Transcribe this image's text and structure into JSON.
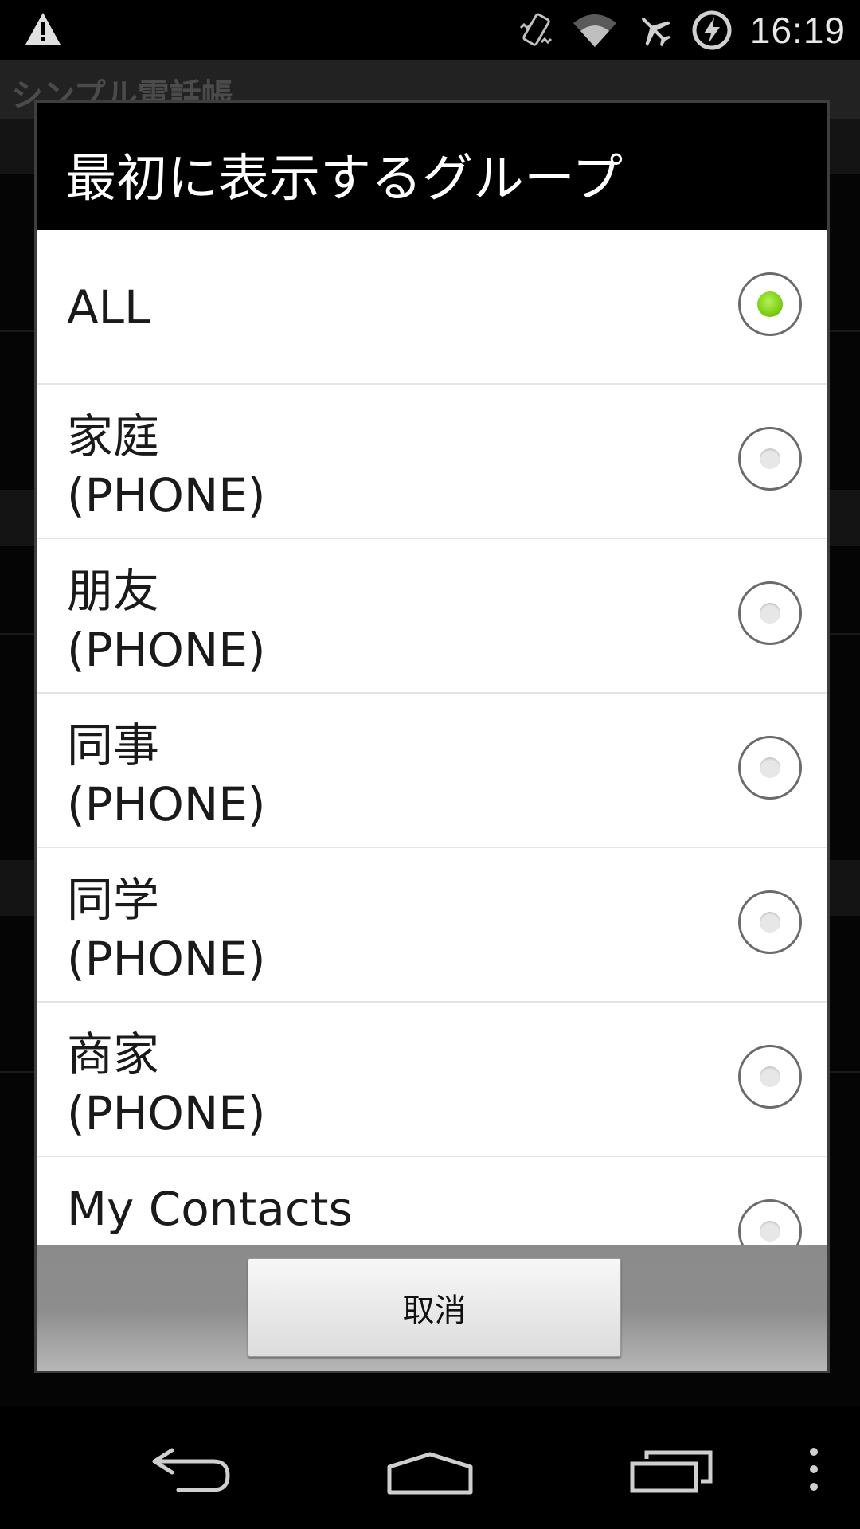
{
  "status_bar": {
    "time": "16:19",
    "icons": [
      "warning-icon",
      "vibrate-icon",
      "wifi-icon",
      "airplane-icon",
      "battery-charging-icon"
    ]
  },
  "background_app": {
    "title": "シンプル電話帳"
  },
  "dialog": {
    "title": "最初に表示するグループ",
    "options": [
      {
        "label": "ALL",
        "sub": "",
        "checked": true
      },
      {
        "label": "家庭",
        "sub": "(PHONE)",
        "checked": false
      },
      {
        "label": "朋友",
        "sub": "(PHONE)",
        "checked": false
      },
      {
        "label": "同事",
        "sub": "(PHONE)",
        "checked": false
      },
      {
        "label": "同学",
        "sub": "(PHONE)",
        "checked": false
      },
      {
        "label": "商家",
        "sub": "(PHONE)",
        "checked": false
      },
      {
        "label": "My Contacts",
        "sub": "",
        "checked": false
      }
    ],
    "cancel_label": "取消"
  },
  "nav_bar": {
    "icons": [
      "back-icon",
      "home-icon",
      "recents-icon",
      "menu-icon"
    ]
  },
  "colors": {
    "radio_checked": "#7bcf12",
    "dialog_title_bg": "#000000",
    "list_bg": "#ffffff"
  }
}
